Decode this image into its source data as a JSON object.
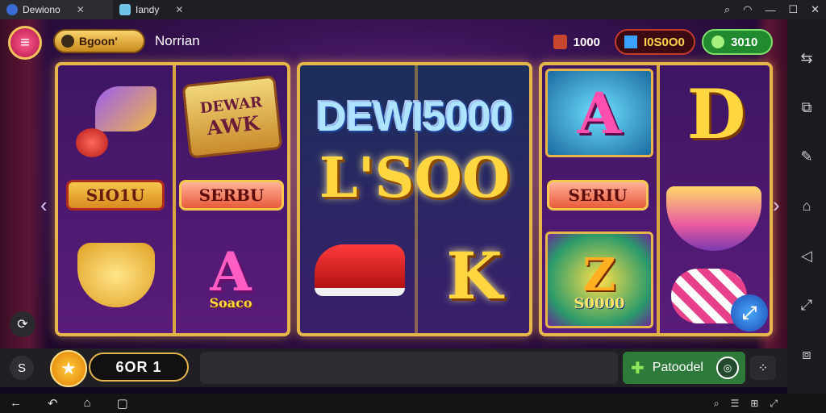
{
  "browser": {
    "tabs": [
      {
        "label": "Dewiono"
      },
      {
        "label": "Iandy"
      }
    ]
  },
  "header": {
    "menu_label": "≡",
    "player_badge": "Bgoon'",
    "nickname": "Norrian",
    "counter_a": "1000",
    "counter_b": "I0S0O0",
    "counter_c": "3010"
  },
  "reels": {
    "left": {
      "banner_title_line1": "DEWAR",
      "banner_title_line2": "AWK",
      "badge_left": "SIO1U",
      "badge_right": "SERBU",
      "letter_a_label": "Soaco"
    },
    "middle": {
      "title_line1": "DEWI5000",
      "title_line2": "L'SOO",
      "letter_k": "K"
    },
    "right": {
      "letter_a": "A",
      "badge": "SERIU",
      "letter_d": "D",
      "tile_value": "S0000"
    }
  },
  "footer": {
    "left_button": "S",
    "bet_value": "6OR 1",
    "reload_label": "Patoodel"
  },
  "colors": {
    "gold": "#e7b64a",
    "accent_red": "#c23a2c",
    "accent_green": "#1f8a2e"
  }
}
